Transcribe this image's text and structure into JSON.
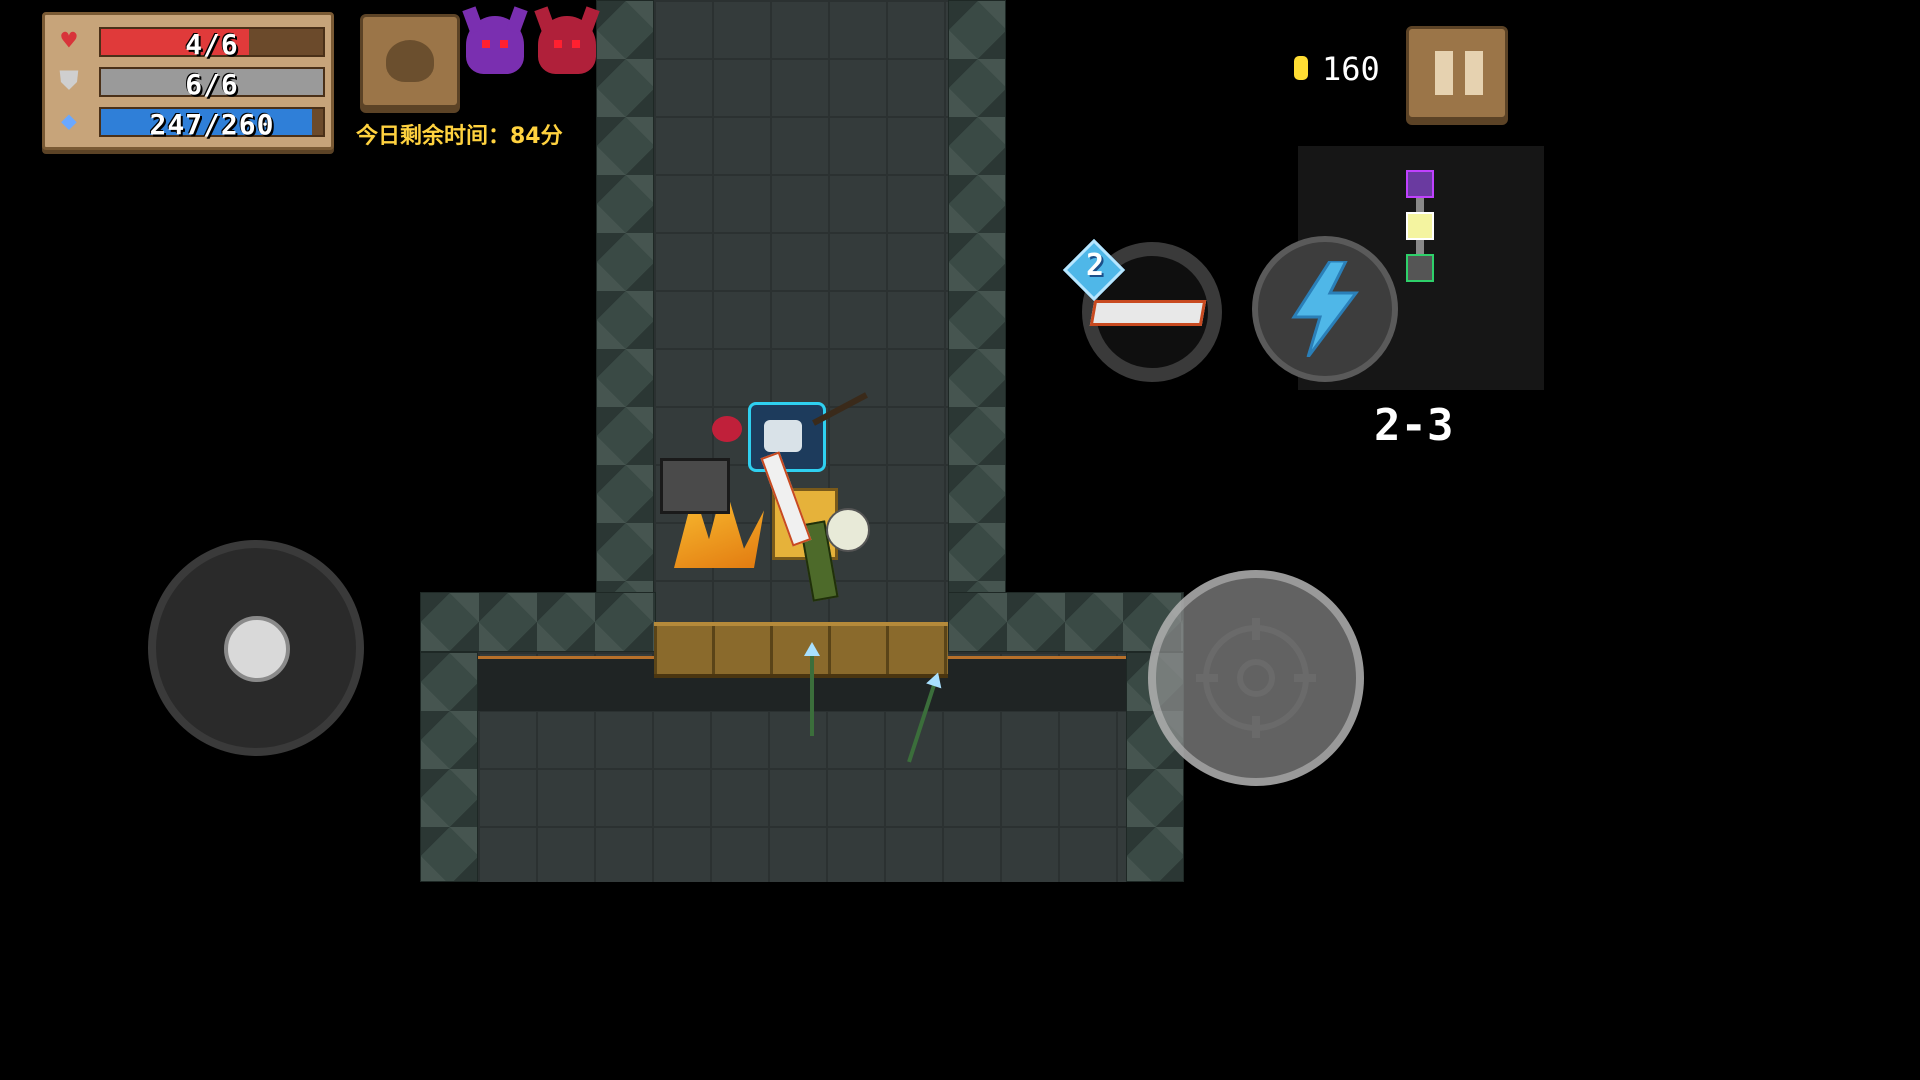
{
  "hud": {
    "health": {
      "text": "4/6",
      "current": 4,
      "max": 6,
      "color": "#e03a3a"
    },
    "armor": {
      "text": "6/6",
      "current": 6,
      "max": 6,
      "color": "#9a9a9a"
    },
    "energy": {
      "text": "247/260",
      "current": 247,
      "max": 260,
      "color": "#2f7fd8"
    },
    "time_left": "今日剩余时间：84分",
    "coins": "160",
    "level": "2-3",
    "weapon_energy_cost": "2"
  },
  "buffs": [
    {
      "icon": "purple-demon-helmet-icon",
      "color": "#7a2fb0"
    },
    {
      "icon": "red-demon-helmet-icon",
      "color": "#b0203a"
    }
  ],
  "minimap": {
    "rooms": [
      "boss-room-icon",
      "event-room-icon",
      "start-room-icon"
    ],
    "colors": {
      "boss": "#6a3aa0",
      "event": "#f4f4a0",
      "start": "#2ed06a"
    }
  },
  "colors": {
    "accent_gold": "#ffd23f",
    "panel": "#c7a47a",
    "button": "#9b7548"
  }
}
